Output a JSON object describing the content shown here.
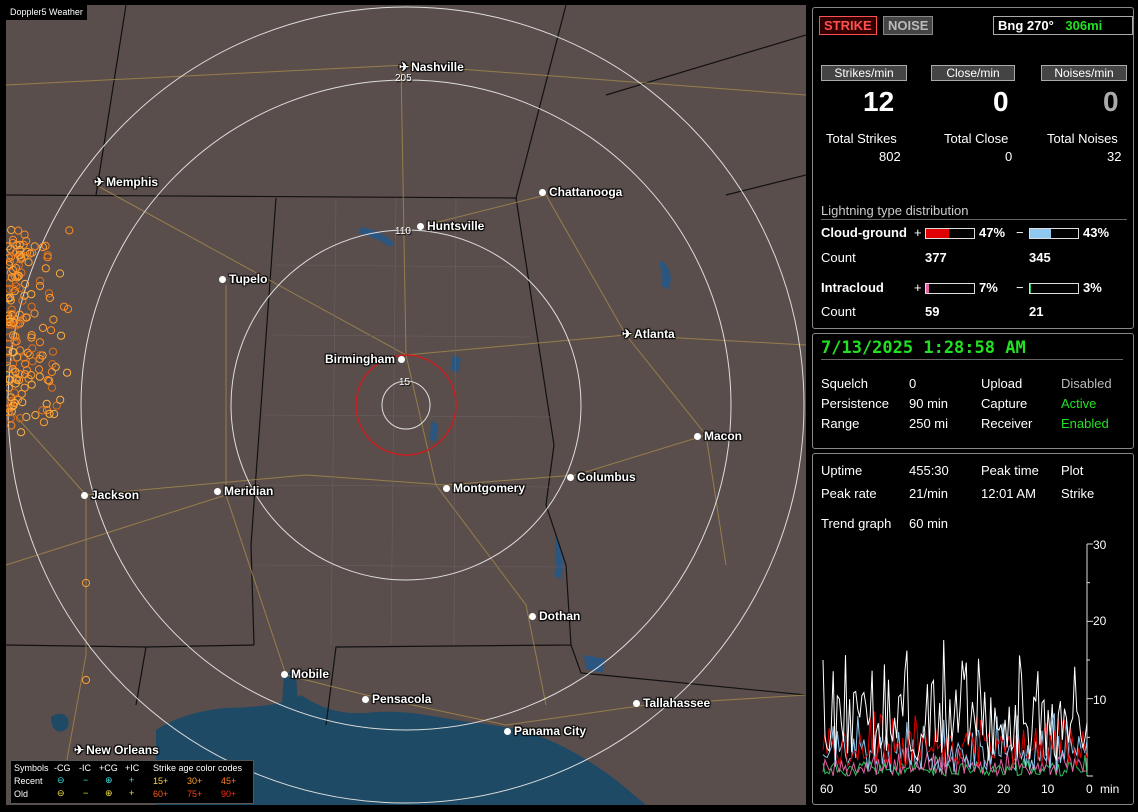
{
  "app_title": "Doppler5 Weather",
  "map": {
    "cities": [
      {
        "name": "Nashville",
        "type": "airport"
      },
      {
        "name": "Memphis",
        "type": "airport"
      },
      {
        "name": "Chattanooga",
        "type": "city"
      },
      {
        "name": "Huntsville",
        "type": "city"
      },
      {
        "name": "Tupelo",
        "type": "city"
      },
      {
        "name": "Atlanta",
        "type": "airport"
      },
      {
        "name": "Birmingham",
        "type": "city"
      },
      {
        "name": "Macon",
        "type": "city"
      },
      {
        "name": "Jackson",
        "type": "city"
      },
      {
        "name": "Meridian",
        "type": "city"
      },
      {
        "name": "Montgomery",
        "type": "city"
      },
      {
        "name": "Columbus",
        "type": "city"
      },
      {
        "name": "Dothan",
        "type": "city"
      },
      {
        "name": "Mobile",
        "type": "city"
      },
      {
        "name": "Pensacola",
        "type": "city"
      },
      {
        "name": "Tallahassee",
        "type": "city"
      },
      {
        "name": "Panama City",
        "type": "city"
      },
      {
        "name": "New Orleans",
        "type": "airport"
      }
    ],
    "ring_labels": [
      "205",
      "110",
      "15"
    ],
    "legend": {
      "symbols_label": "Symbols",
      "cols": [
        "-CG",
        "-IC",
        "+CG",
        "+IC"
      ],
      "recent_label": "Recent",
      "old_label": "Old",
      "age_title": "Strike age color codes",
      "recent_ages": [
        "15+",
        "30+",
        "45+"
      ],
      "old_ages": [
        "60+",
        "75+",
        "90+"
      ],
      "age_colors": [
        "#ffd24a",
        "#ffa030",
        "#ff7a20",
        "#ff5a18",
        "#ff4010",
        "#ff2a10"
      ]
    }
  },
  "status": {
    "strike_label": "STRIKE",
    "noise_label": "NOISE",
    "bearing": "Bng 270°",
    "distance": "306mi",
    "strikes_per_min_label": "Strikes/min",
    "close_per_min_label": "Close/min",
    "noises_per_min_label": "Noises/min",
    "strikes_per_min": "12",
    "close_per_min": "0",
    "noises_per_min": "0",
    "total_strikes_label": "Total Strikes",
    "total_close_label": "Total Close",
    "total_noises_label": "Total Noises",
    "total_strikes": "802",
    "total_close": "0",
    "total_noises": "32",
    "dist_title": "Lightning type distribution",
    "cg_label": "Cloud-ground",
    "ic_label": "Intracloud",
    "count_label": "Count",
    "plus": "+",
    "minus": "−",
    "cg_pos_pct": "47%",
    "cg_pos_frac": 0.47,
    "cg_neg_pct": "43%",
    "cg_neg_frac": 0.43,
    "cg_pos_count": "377",
    "cg_neg_count": "345",
    "ic_pos_pct": "7%",
    "ic_pos_frac": 0.07,
    "ic_neg_pct": "3%",
    "ic_neg_frac": 0.03,
    "ic_pos_count": "59",
    "ic_neg_count": "21",
    "colors": {
      "cg_pos": "#e00000",
      "cg_neg": "#8ec8f0",
      "ic_pos": "#e060a0",
      "ic_neg": "#30c060",
      "green": "#22e022"
    }
  },
  "settings": {
    "datetime": "7/13/2025 1:28:58 AM",
    "squelch_label": "Squelch",
    "squelch": "0",
    "persistence_label": "Persistence",
    "persistence": "90 min",
    "range_label": "Range",
    "range": "250 mi",
    "upload_label": "Upload",
    "upload": "Disabled",
    "capture_label": "Capture",
    "capture": "Active",
    "receiver_label": "Receiver",
    "receiver": "Enabled"
  },
  "trend": {
    "uptime_label": "Uptime",
    "uptime": "455:30",
    "peak_time_label": "Peak time",
    "peak_time": "12:01 AM",
    "plot_label": "Plot",
    "plot": "Strike",
    "peak_rate_label": "Peak rate",
    "peak_rate": "21/min",
    "trend_graph_label": "Trend graph",
    "trend_graph": "60 min",
    "y_ticks": [
      "30",
      "20",
      "10"
    ],
    "x_ticks": [
      "60",
      "50",
      "40",
      "30",
      "20",
      "10",
      "0"
    ],
    "x_unit": "min",
    "ylim": [
      0,
      30
    ]
  }
}
